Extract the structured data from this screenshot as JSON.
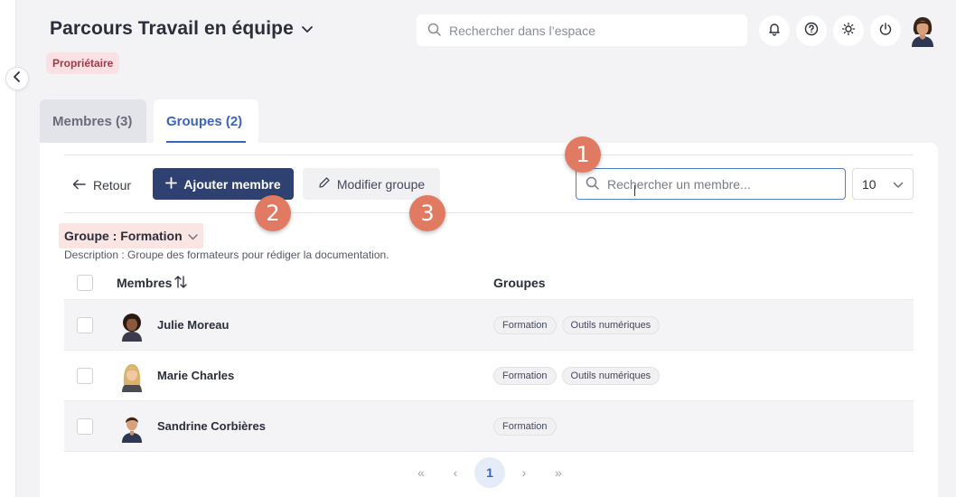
{
  "header": {
    "title": "Parcours Travail en équipe",
    "role_badge": "Propriétaire",
    "search_placeholder": "Rechercher dans l’espace"
  },
  "icons": {
    "collapse": "chevron-left-icon",
    "notifications": "bell-icon",
    "help": "question-icon",
    "theme": "sun-icon",
    "logout": "power-icon"
  },
  "tabs": [
    {
      "label": "Membres (3)",
      "active": false
    },
    {
      "label": "Groupes (2)",
      "active": true
    }
  ],
  "toolbar": {
    "back_label": "Retour",
    "add_label": "Ajouter membre",
    "edit_label": "Modifier groupe",
    "search_placeholder": "Rechercher un membre...",
    "per_page": "10"
  },
  "annotations": [
    "1",
    "2",
    "3"
  ],
  "group": {
    "label": "Groupe : Formation",
    "description": "Description : Groupe des formateurs pour rédiger la documentation."
  },
  "table": {
    "columns": [
      "Membres",
      "Groupes"
    ],
    "rows": [
      {
        "name": "Julie Moreau",
        "groups": [
          "Formation",
          "Outils numériques"
        ]
      },
      {
        "name": "Marie Charles",
        "groups": [
          "Formation",
          "Outils numériques"
        ]
      },
      {
        "name": "Sandrine Corbières",
        "groups": [
          "Formation"
        ]
      }
    ]
  },
  "pagination": {
    "first": "«",
    "prev": "‹",
    "current": "1",
    "next": "›",
    "last": "»"
  },
  "colors": {
    "primary_button": "#2f4170",
    "active_tab": "#3d63b8",
    "badge": "#e07a62",
    "owner_badge_bg": "#fbe1e4"
  }
}
